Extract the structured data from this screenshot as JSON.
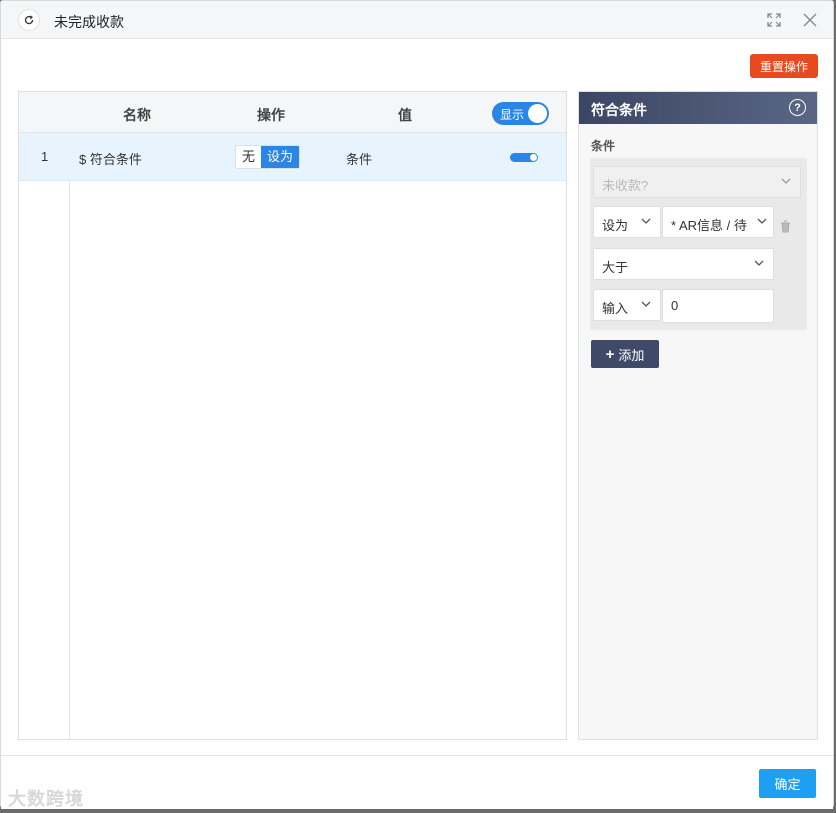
{
  "window": {
    "title": "未完成收款"
  },
  "toolbar": {
    "reset_label": "重置操作"
  },
  "table": {
    "columns": [
      "名称",
      "操作",
      "值"
    ],
    "show_toggle_label": "显示",
    "rows": [
      {
        "index": "1",
        "name": "$ 符合条件",
        "op_none": "无",
        "op_set": "设为",
        "value": "条件",
        "visible": true
      }
    ]
  },
  "condition_panel": {
    "title": "符合条件",
    "help": "?",
    "section_label": "条件",
    "field_select": "未收款?",
    "action_select": "设为",
    "target_select": "* AR信息 / 待",
    "operator_select": "大于",
    "input_type_select": "输入",
    "input_value": "0",
    "add_label": "添加"
  },
  "footer": {
    "ok_label": "确定"
  },
  "watermark": "大数跨境"
}
